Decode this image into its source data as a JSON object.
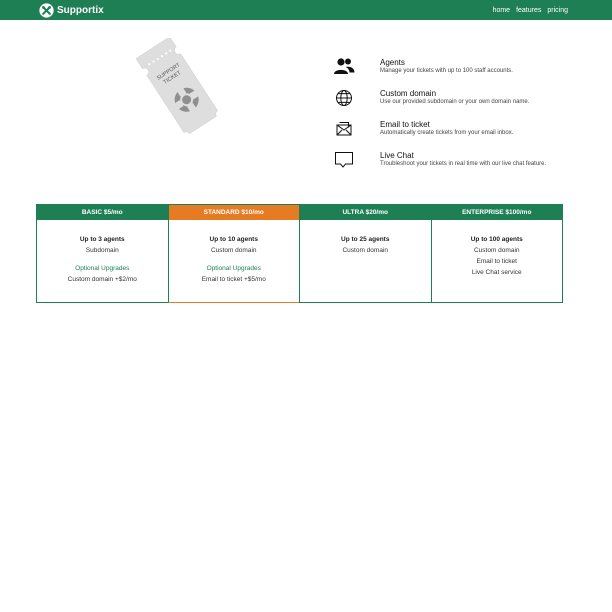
{
  "brand": {
    "name": "Supportix",
    "icon": "crossed-tools-icon"
  },
  "nav": {
    "links": [
      "home",
      "features",
      "pricing"
    ]
  },
  "hero": {
    "icon": "support-ticket-illustration",
    "ticket_text": "SUPPORT TICKET"
  },
  "features": [
    {
      "icon": "users-icon",
      "title": "Agents",
      "desc": "Manage your tickets with up to 100 staff accounts."
    },
    {
      "icon": "globe-icon",
      "title": "Custom domain",
      "desc": "Use our provided subdomain or your own domain name."
    },
    {
      "icon": "envelope-icon",
      "title": "Email to ticket",
      "desc": "Automatically create tickets from your email inbox."
    },
    {
      "icon": "chat-bubble-icon",
      "title": "Live Chat",
      "desc": "Troubleshoot your tickets in real time with our live chat feature."
    }
  ],
  "plans": [
    {
      "name": "BASIC $5/mo",
      "agents": "Up to 3 agents",
      "features": [
        "Subdomain"
      ],
      "upgrades_title": "Optional Upgrades",
      "upgrades": [
        "Custom domain +$2/mo"
      ]
    },
    {
      "name": "STANDARD $10/mo",
      "agents": "Up to 10 agents",
      "features": [
        "Custom domain"
      ],
      "upgrades_title": "Optional Upgrades",
      "upgrades": [
        "Email to ticket +$5/mo"
      ],
      "featured": true
    },
    {
      "name": "ULTRA $20/mo",
      "agents": "Up to 25 agents",
      "features": [
        "Custom domain"
      ]
    },
    {
      "name": "ENTERPRISE $100/mo",
      "agents": "Up to 100 agents",
      "features": [
        "Custom domain",
        "Email to ticket",
        "Live Chat service"
      ]
    }
  ],
  "colors": {
    "brand_green": "#1e7f55",
    "accent_orange": "#e57c23"
  }
}
